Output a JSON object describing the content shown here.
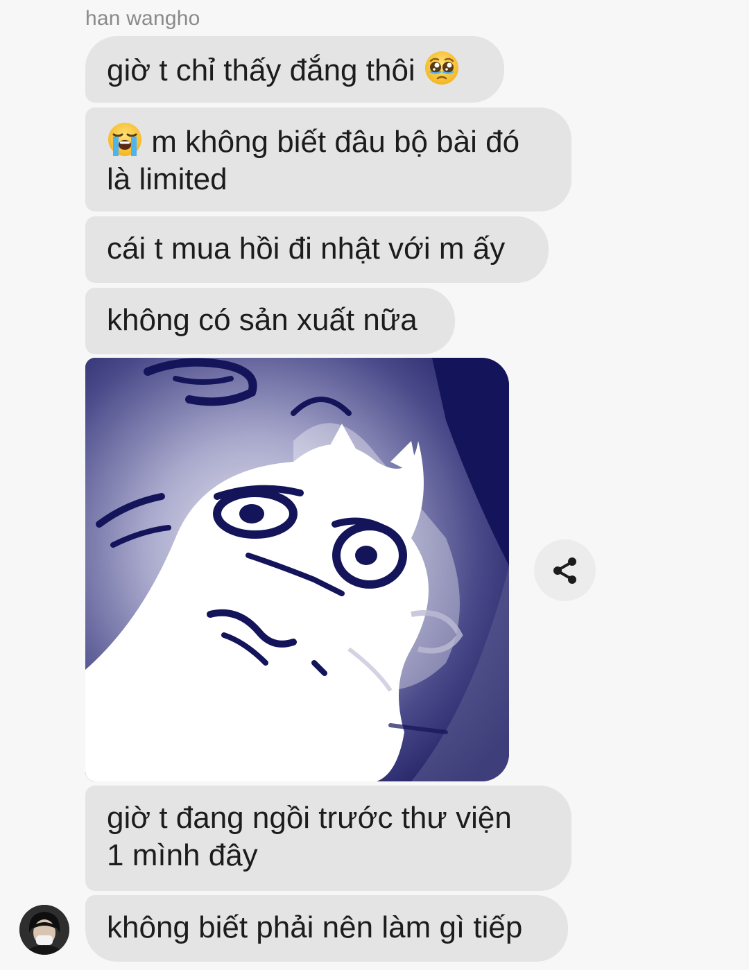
{
  "sender": {
    "name": "han wangho"
  },
  "messages": [
    {
      "text": "giờ t chỉ thấy đắng thôi ",
      "emoji": "pleading-face-icon"
    },
    {
      "text": " m không biết đâu bộ bài đó\nlà limited",
      "emoji": "loudly-crying-face-icon"
    },
    {
      "text": "cái t mua hồi đi nhật với m ấy"
    },
    {
      "text": "không có sản xuất nữa"
    },
    {
      "type": "image",
      "content": "sticker-crying-cat"
    },
    {
      "text": "giờ t đang ngồi trước thư viện\n1 mình đây"
    },
    {
      "text": "không biết phải nên làm gì tiếp"
    }
  ],
  "actions": {
    "share_icon": "share-icon"
  },
  "colors": {
    "background": "#f7f7f7",
    "bubble": "#e4e4e4",
    "text": "#1c1c1c",
    "sender_name": "#8a8a8a",
    "sticker_dark": "#14145a"
  }
}
